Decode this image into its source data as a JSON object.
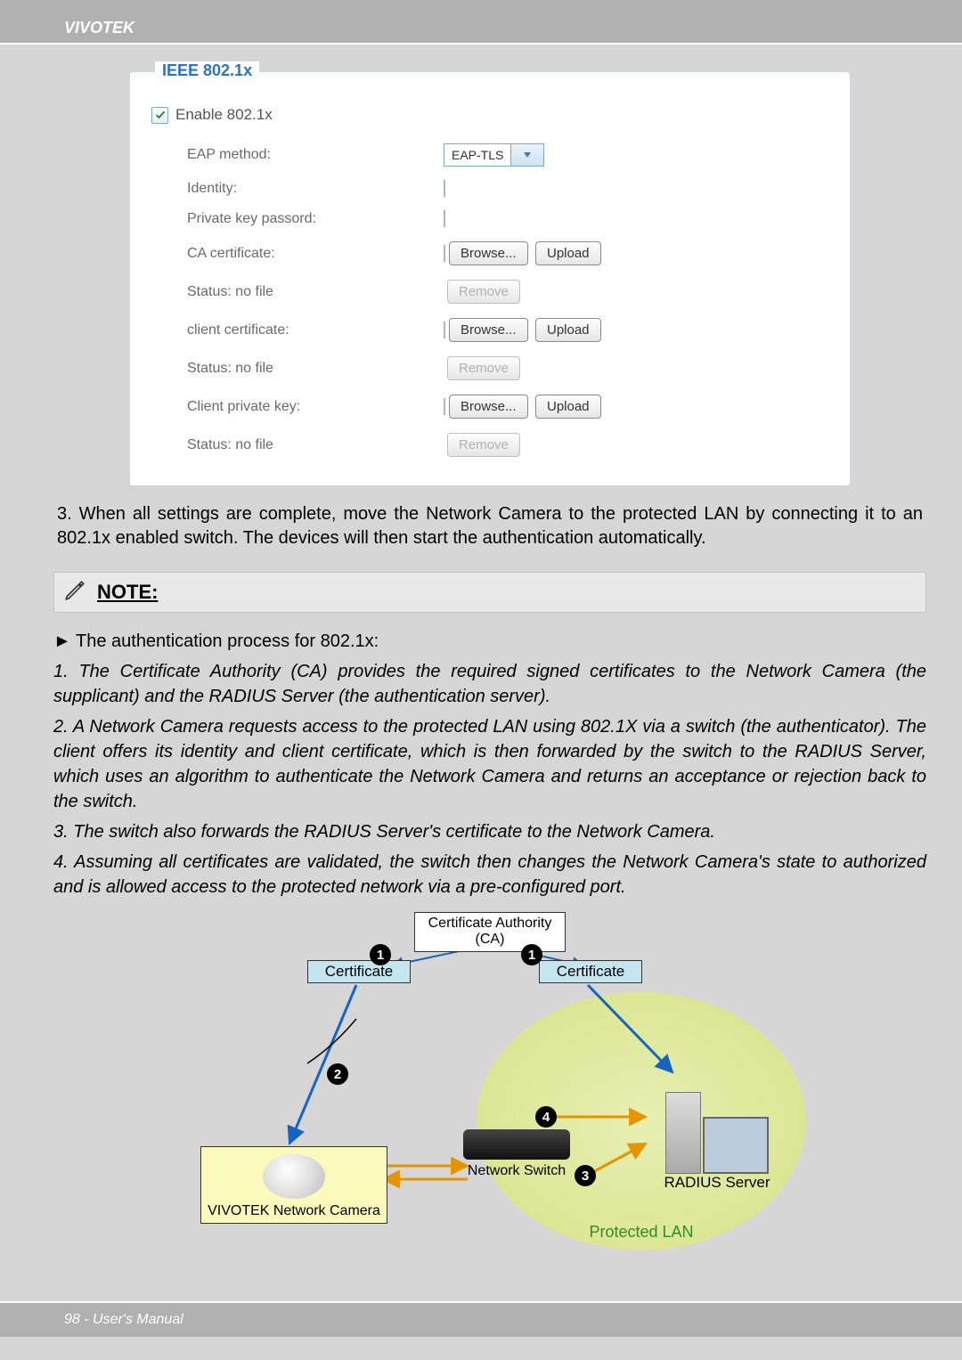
{
  "brand": "VIVOTEK",
  "footer": "98 - User's Manual",
  "panel": {
    "legend": "IEEE 802.1x",
    "enable_label": "Enable 802.1x",
    "rows": {
      "eap_method_label": "EAP method:",
      "eap_method_value": "EAP-TLS",
      "identity_label": "Identity:",
      "pkp_label": "Private key passord:",
      "ca_label": "CA certificate:",
      "status_label_1": "Status:   no file",
      "client_cert_label": "client certificate:",
      "status_label_2": "Status:   no file",
      "client_pk_label": "Client private key:",
      "status_label_3": "Status:   no file",
      "browse": "Browse...",
      "upload": "Upload",
      "remove": "Remove"
    }
  },
  "instruction3": "3. When all settings are complete, move the Network Camera to the protected LAN by connecting it to an 802.1x enabled switch. The devices will then start the authentication automatically.",
  "note_title": "NOTE:",
  "notes": {
    "bullet": "► The authentication process for 802.1x:",
    "n1": "1. The Certificate Authority (CA) provides the required signed certificates to the Network Camera (the supplicant) and the RADIUS Server (the authentication server).",
    "n2": "2. A Network Camera requests access to the protected LAN using 802.1X via a switch (the authenticator). The client offers its identity and client certificate, which is then forwarded by the switch to the RADIUS Server, which uses an algorithm to authenticate the Network Camera and returns an acceptance or rejection back to the switch.",
    "n3": "3. The switch also forwards the RADIUS Server's certificate to the Network Camera.",
    "n4": "4. Assuming all certificates are validated, the switch then changes the Network Camera's state to authorized and is allowed access to the protected network via a pre-configured port."
  },
  "diagram": {
    "ca": "Certificate Authority (CA)",
    "cert": "Certificate",
    "camera": "VIVOTEK Network Camera",
    "switch": "Network Switch",
    "radius": "RADIUS Server",
    "protected": "Protected LAN",
    "steps": {
      "s1": "1",
      "s2": "2",
      "s3": "3",
      "s4": "4"
    }
  }
}
